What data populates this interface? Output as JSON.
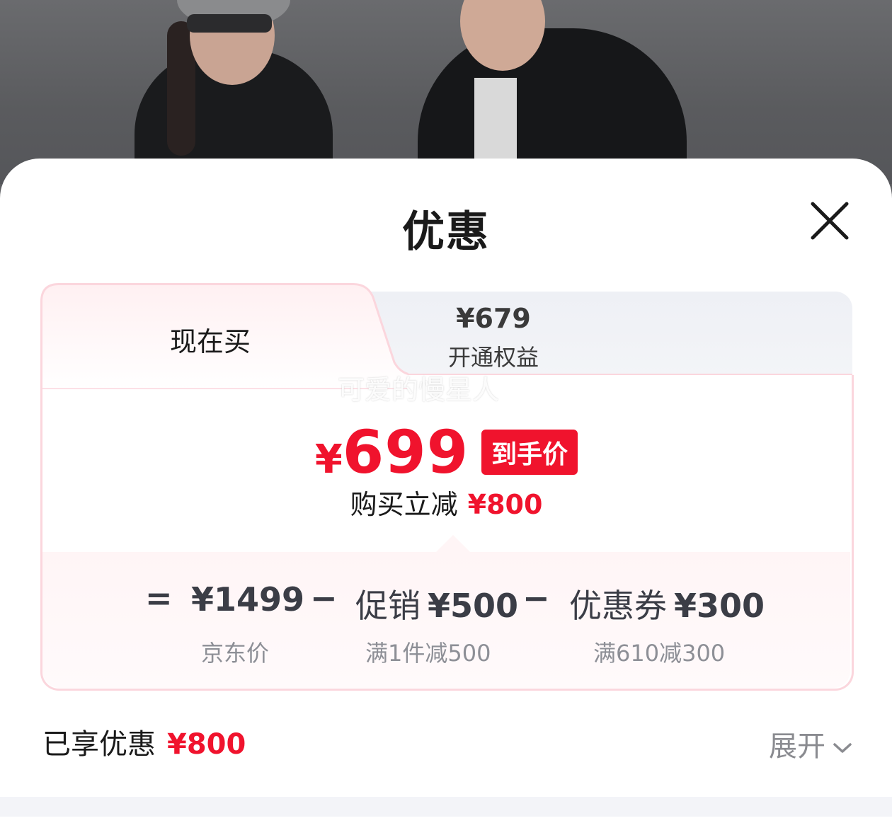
{
  "sheet": {
    "title": "优惠",
    "close_icon": "close-icon"
  },
  "tabs": [
    {
      "label": "现在买"
    },
    {
      "price": "¥679",
      "label": "开通权益"
    }
  ],
  "watermark": "可爱的慢星人",
  "price": {
    "yen": "¥",
    "amount": "699",
    "tag": "到手价",
    "save_label": "购买立减",
    "save_amount": "¥800"
  },
  "breakdown": {
    "eq": "=",
    "minus": "−",
    "items": [
      {
        "main": "¥1499",
        "sub": "京东价"
      },
      {
        "cn": "促销",
        "main": "¥500",
        "sub": "满1件减500"
      },
      {
        "cn": "优惠券",
        "main": "¥300",
        "sub": "满610减300"
      }
    ]
  },
  "footer": {
    "enjoyed_label": "已享优惠",
    "enjoyed_amount": "¥800",
    "expand_label": "展开"
  },
  "colors": {
    "accent": "#f0132d",
    "border": "#fbd6dd",
    "text": "#1a1a1a",
    "muted": "#8d8f96"
  }
}
